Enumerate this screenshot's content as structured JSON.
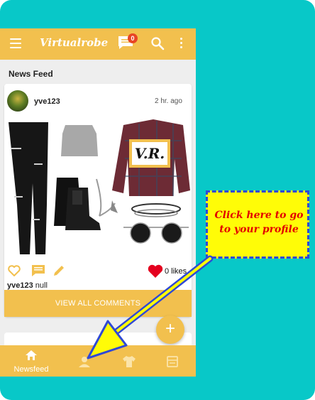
{
  "app": {
    "title": "Virtualrobe",
    "notification_count": "0"
  },
  "feed": {
    "title": "News Feed"
  },
  "post": {
    "username": "yve123",
    "time": "2 hr. ago",
    "logo_text": "V.R.",
    "likes": "0 likes",
    "caption_user": "yve123",
    "caption_text": "null",
    "view_comments": "VIEW ALL COMMENTS"
  },
  "bottom_nav": {
    "newsfeed": "Newsfeed"
  },
  "annotation": {
    "text": "Click here to go to your profile"
  },
  "colors": {
    "appbar": "#f2c04e",
    "background": "#08c8c8",
    "callout": "#fffc07",
    "callout_text": "#e30000",
    "arrow": "#2f49d6",
    "like": "#e4001f"
  }
}
